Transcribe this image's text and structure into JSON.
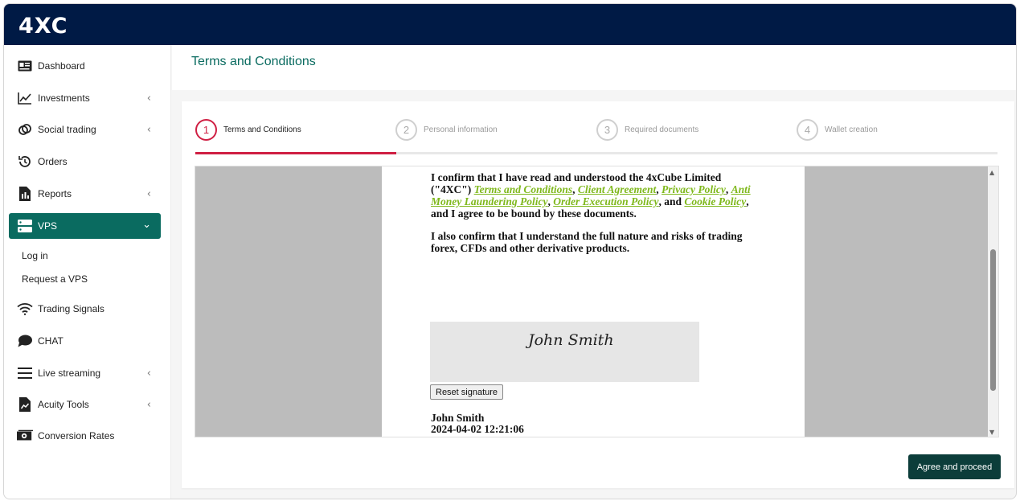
{
  "brand": {
    "logo_text": "4XC"
  },
  "sidebar": {
    "items": [
      {
        "label": "Dashboard",
        "icon": "dashboard-icon"
      },
      {
        "label": "Investments",
        "icon": "chart-line-icon"
      },
      {
        "label": "Social trading",
        "icon": "link-icon"
      },
      {
        "label": "Orders",
        "icon": "history-icon"
      },
      {
        "label": "Reports",
        "icon": "report-icon"
      },
      {
        "label": "VPS",
        "icon": "server-icon"
      },
      {
        "label": "Trading Signals",
        "icon": "wifi-icon"
      },
      {
        "label": "CHAT",
        "icon": "chat-icon"
      },
      {
        "label": "Live streaming",
        "icon": "menu-icon"
      },
      {
        "label": "Acuity Tools",
        "icon": "file-chart-icon"
      },
      {
        "label": "Conversion Rates",
        "icon": "money-icon"
      }
    ],
    "vps_subitems": [
      "Log in",
      "Request a VPS"
    ]
  },
  "page": {
    "title": "Terms and Conditions"
  },
  "steps": [
    {
      "number": "1",
      "label": "Terms and Conditions",
      "active": true
    },
    {
      "number": "2",
      "label": "Personal information"
    },
    {
      "number": "3",
      "label": "Required documents"
    },
    {
      "number": "4",
      "label": "Wallet creation"
    }
  ],
  "document": {
    "para1_prefix": "I confirm that I have read and understood the 4xCube Limited (\"4XC\") ",
    "link_terms": "Terms and Conditions",
    "link_client": "Client Agreement",
    "link_privacy": "Privacy Policy",
    "link_aml": "Anti Money Laundering Policy",
    "link_execution": "Order Execution Policy",
    "sep_comma": ", ",
    "sep_and": ", and ",
    "link_cookie": "Cookie Policy",
    "para1_suffix": ", and I agree to be bound by these documents.",
    "para2": "I also confirm that I understand the full nature and risks of trading forex, CFDs and other derivative products.",
    "signature": "John Smith",
    "reset_label": "Reset signature",
    "signer_name": "John Smith",
    "signed_at": "2024-04-02 12:21:06"
  },
  "actions": {
    "agree_label": "Agree and proceed"
  },
  "colors": {
    "topbar": "#001a45",
    "accent": "#0a6b60",
    "step_active": "#cf1f43",
    "link": "#7fb81c",
    "button": "#0c3d3a"
  }
}
